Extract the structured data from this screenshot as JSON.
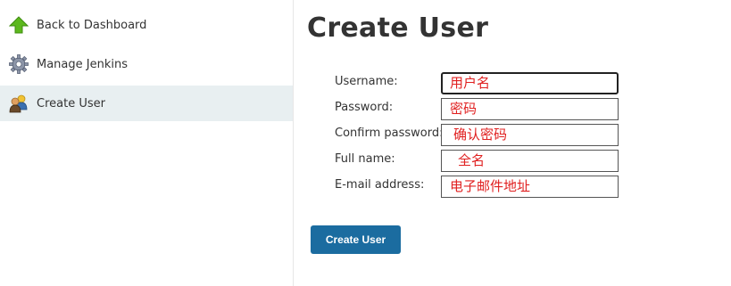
{
  "sidebar": {
    "items": [
      {
        "label": "Back to Dashboard",
        "icon": "up-arrow-icon",
        "active": false
      },
      {
        "label": "Manage Jenkins",
        "icon": "gear-icon",
        "active": false
      },
      {
        "label": "Create User",
        "icon": "users-icon",
        "active": true
      }
    ]
  },
  "main": {
    "title": "Create User",
    "form": {
      "username": {
        "label": "Username:",
        "value": "用户名"
      },
      "password": {
        "label": "Password:",
        "value": "密码"
      },
      "confirm_password": {
        "label": "Confirm password:",
        "value": "确认密码"
      },
      "full_name": {
        "label": "Full name:",
        "value": "全名"
      },
      "email": {
        "label": "E-mail address:",
        "value": "电子邮件地址"
      }
    },
    "submit_label": "Create User"
  },
  "colors": {
    "accent_button": "#1b6ca0",
    "active_sidebar_bg": "#e8eff1",
    "input_text": "#e02020"
  }
}
